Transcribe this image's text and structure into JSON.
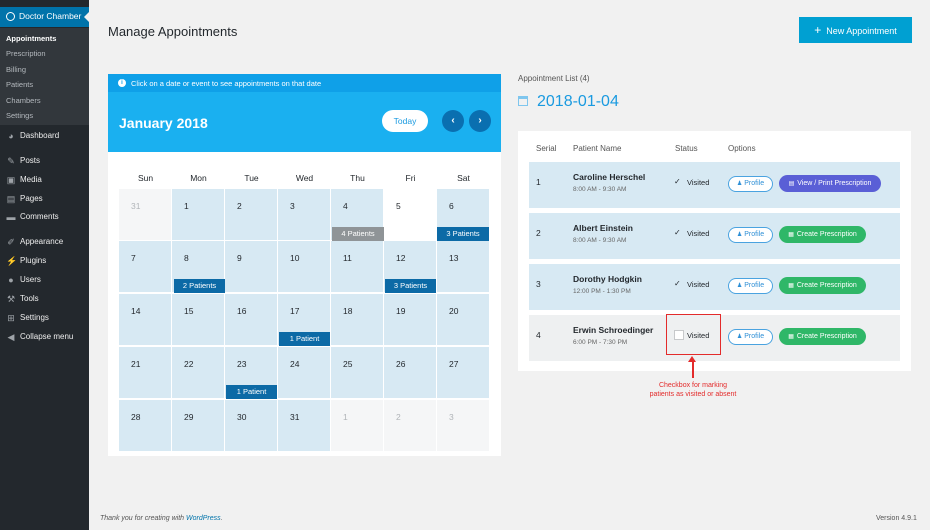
{
  "sidebar": {
    "plugin_title": "Doctor Chamber",
    "submenu": [
      "Appointments",
      "Prescription",
      "Billing",
      "Patients",
      "Chambers",
      "Settings"
    ],
    "menu": [
      {
        "label": "Dashboard",
        "icon": "dashboard-icon"
      },
      {
        "label": "Posts",
        "icon": "pin-icon"
      },
      {
        "label": "Media",
        "icon": "media-icon"
      },
      {
        "label": "Pages",
        "icon": "pages-icon"
      },
      {
        "label": "Comments",
        "icon": "comments-icon"
      },
      {
        "label": "Appearance",
        "icon": "appearance-icon"
      },
      {
        "label": "Plugins",
        "icon": "plugins-icon"
      },
      {
        "label": "Users",
        "icon": "users-icon"
      },
      {
        "label": "Tools",
        "icon": "tools-icon"
      },
      {
        "label": "Settings",
        "icon": "settings-icon"
      },
      {
        "label": "Collapse menu",
        "icon": "collapse-icon"
      }
    ]
  },
  "header": {
    "title": "Manage Appointments",
    "new_button": "New Appointment"
  },
  "calendar": {
    "note": "Click on a date or event to see appointments on that date",
    "month": "January 2018",
    "today_label": "Today",
    "prev_icon": "‹",
    "next_icon": "›",
    "weekdays": [
      "Sun",
      "Mon",
      "Tue",
      "Wed",
      "Thu",
      "Fri",
      "Sat"
    ],
    "weeks": [
      [
        "31",
        "1",
        "2",
        "3",
        "4",
        "5",
        "6"
      ],
      [
        "7",
        "8",
        "9",
        "10",
        "11",
        "12",
        "13"
      ],
      [
        "14",
        "15",
        "16",
        "17",
        "18",
        "19",
        "20"
      ],
      [
        "21",
        "22",
        "23",
        "24",
        "25",
        "26",
        "27"
      ],
      [
        "28",
        "29",
        "30",
        "31",
        "1",
        "2",
        "3"
      ]
    ],
    "events": {
      "thu_4": "4 Patients",
      "sat_6": "3 Patients",
      "mon_8": "2 Patients",
      "fri_12": "3 Patients",
      "wed_17": "1 Patient",
      "tue_23": "1 Patient"
    }
  },
  "appointments": {
    "title": "Appointment List (4)",
    "date": "2018-01-04",
    "columns": [
      "Serial",
      "Patient Name",
      "Status",
      "Options"
    ],
    "rows": [
      {
        "serial": "1",
        "name": "Caroline Herschel",
        "time": "8:00 AM - 9:30 AM",
        "visited": "✓",
        "status": "Visited",
        "profile": "Profile",
        "action": "View / Print Prescription"
      },
      {
        "serial": "2",
        "name": "Albert Einstein",
        "time": "8:00 AM - 9:30 AM",
        "visited": "✓",
        "status": "Visited",
        "profile": "Profile",
        "action": "Create Prescription"
      },
      {
        "serial": "3",
        "name": "Dorothy Hodgkin",
        "time": "12:00 PM - 1:30 PM",
        "visited": "✓",
        "status": "Visited",
        "profile": "Profile",
        "action": "Create Prescription"
      },
      {
        "serial": "4",
        "name": "Erwin Schroedinger",
        "time": "6:00 PM - 7:30 PM",
        "visited": "",
        "status": "Visited",
        "profile": "Profile",
        "action": "Create Prescription"
      }
    ]
  },
  "annotation": "Checkbox for marking patients as visited or absent",
  "footer": {
    "text": "Thank you for creating with",
    "link": "WordPress",
    "version": "Version 4.9.1"
  },
  "colors": {
    "sidebar": "#23282d",
    "accent": "#00a0d2",
    "calendar_header": "#1ab0f0",
    "event_blue": "#0c6aa6",
    "green": "#2fb768",
    "purple": "#5a5fd6",
    "annotation": "#e32b2b"
  }
}
